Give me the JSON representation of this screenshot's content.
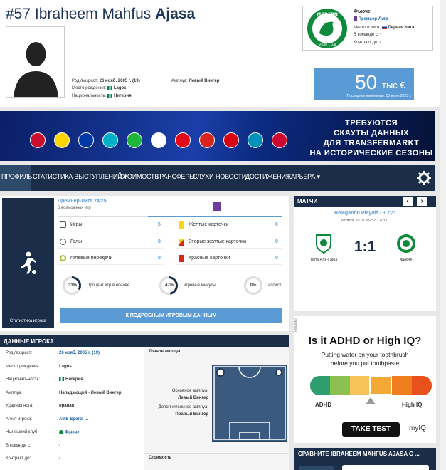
{
  "player": {
    "number": "#57",
    "first_names": "Ibraheem Mahfus",
    "last_name": "Ajasa",
    "dob_label": "Род./возраст:",
    "dob_value": "26 нояб. 2005 г. (19)",
    "birthplace_label": "Место рождения:",
    "birthplace_value": "Lagos",
    "citizenship_label": "Национальность:",
    "citizenship_value": "Нигерия",
    "position_label": "Амплуа:",
    "position_value": "Левый Вингер"
  },
  "club": {
    "name": "Фьюче",
    "league": "Премьер-Лига",
    "league_level_label": "Место в лиге:",
    "league_level_value": "Первая лига",
    "joined_label": "В команде с:",
    "joined_value": "-",
    "contract_label": "Контракт до:",
    "contract_value": "-",
    "logo_text_top": "MODERN",
    "logo_text_bottom": "SPORT CLUB"
  },
  "market_value": {
    "amount": "50",
    "currency": "тыс €",
    "updated": "Последнее изменение: 13 июня 2025 г."
  },
  "banner": {
    "line1": "ТРЕБУЮТСЯ",
    "line2": "СКАУТЫ ДАННЫХ",
    "line3": "ДЛЯ TRANSFERMARKT",
    "line4": "НА ИСТОРИЧЕСКИЕ СЕЗОНЫ",
    "flag_colors": [
      "#c8102e",
      "#ffd500",
      "#0039a6",
      "#00afca",
      "#1eb53a",
      "#ffffff",
      "#e30a17",
      "#da251d",
      "#d90012",
      "#0092bc",
      "#cc092f"
    ]
  },
  "nav": {
    "items": [
      "ПРОФИЛЬ",
      "СТАТИСТИКА ВЫСТУПЛЕНИЙ ▾",
      "СТОИМОСТЬ",
      "ТРАНСФЕРЫ",
      "СЛУХИ",
      "НОВОСТИ",
      "ДОСТИЖЕНИЯ",
      "КАРЬЕРА ▾"
    ]
  },
  "stats": {
    "side_label": "Статистика игрока",
    "competition": "Премьер-Лига 24/25",
    "possible_games": "6 возможных игр",
    "rows_left": [
      {
        "label": "Игры",
        "value": "5"
      },
      {
        "label": "Голы",
        "value": "0"
      },
      {
        "label": "голевые передачи",
        "value": "0"
      }
    ],
    "rows_right": [
      {
        "label": "Желтые карточки",
        "value": "0"
      },
      {
        "label": "Вторые желтые карточки",
        "value": "0"
      },
      {
        "label": "Красные карточки",
        "value": "0"
      }
    ],
    "rings": [
      {
        "pct": "33%",
        "fraction": 0.33,
        "label": "Процент игр в основе"
      },
      {
        "pct": "47%",
        "fraction": 0.47,
        "label": "игровые минуты"
      },
      {
        "pct": "0%",
        "fraction": 0,
        "label": "ассист"
      }
    ],
    "button": "К ПОДРОБНЫМ ИГРОВЫМ ДАННЫМ"
  },
  "matches": {
    "title": "МАТЧИ",
    "competition": "Relegation Playoff",
    "round": "- 9. тур",
    "date": "четверг, 29.05.2025 г. - 20:00",
    "home": "Тала Аль-Гаиш",
    "away": "Фьюче",
    "score": "1:1"
  },
  "player_data": {
    "title": "ДАННЫЕ ИГРОКА",
    "rows": [
      {
        "label": "Род./возраст:",
        "value": "26 нояб. 2005 г. (19)"
      },
      {
        "label": "Место рождения:",
        "value": "Lagos"
      },
      {
        "label": "Национальность:",
        "value": "Нигерия"
      },
      {
        "label": "Амплуа:",
        "value": "Нападающий - Левый Вингер"
      },
      {
        "label": "Ударная нога:",
        "value": "правая"
      },
      {
        "label": "Агент игрока:",
        "value": "AMB Sports ..."
      },
      {
        "label": "Нынешний клуб:",
        "value": "Фьюче"
      },
      {
        "label": "В команде с:",
        "value": "-"
      },
      {
        "label": "Контракт до:",
        "value": "-"
      }
    ],
    "position_title": "Точное амплуа",
    "main_position_label": "Основное амплуа:",
    "main_position_value": "Левый Вингер",
    "extra_position_label": "Дополнительное амплуа:",
    "extra_position_value": "Правый Вингер",
    "value_title": "Стоимость"
  },
  "ad": {
    "tag": "Реклама",
    "title": "Is it ADHD or High IQ?",
    "subtitle_line1": "Putting water on your toothbrush",
    "subtitle_line2": "before you put toothpaste",
    "left_label": "ADHD",
    "right_label": "High IQ",
    "button": "TAKE TEST",
    "brand": "myIQ",
    "scale_colors": [
      "#2e9e6e",
      "#8cc152",
      "#f6c25a",
      "#f4a836",
      "#f07d1e",
      "#e8501c"
    ]
  },
  "compare": {
    "title": "СРАВНИТЕ IBRAHEEM MAHFUS AJASA С ..."
  }
}
